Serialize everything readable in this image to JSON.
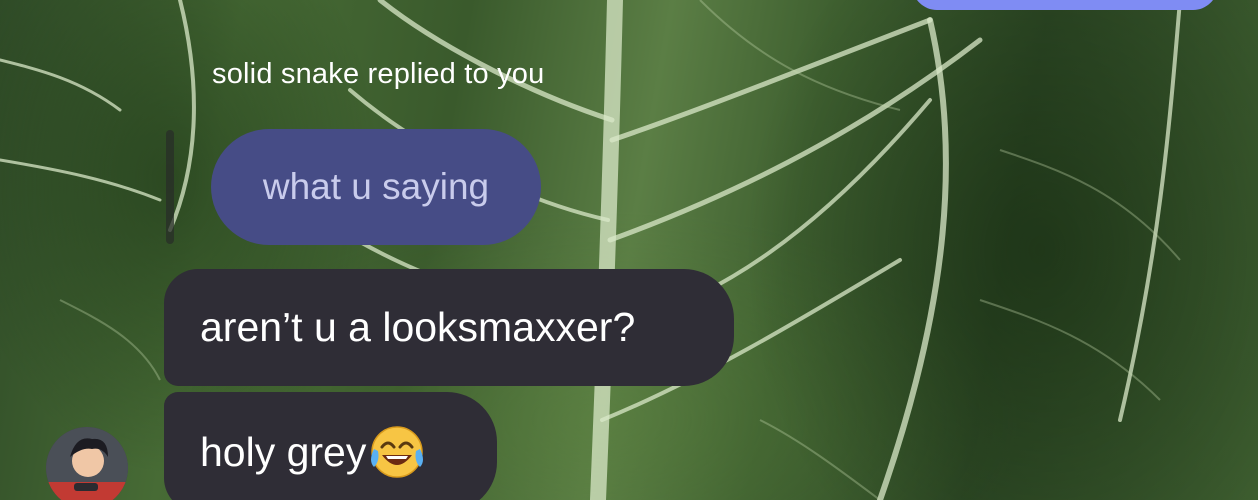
{
  "conversation": {
    "reply_header": "solid snake replied to you",
    "quoted_message": "what u saying",
    "messages": [
      {
        "text": "aren’t u a looksmaxxer?"
      },
      {
        "text": "holy grey",
        "emoji": "face-with-tears-of-joy-icon"
      }
    ],
    "sender_avatar": "user-avatar"
  },
  "colors": {
    "outgoing_bubble": "#7f8cf3",
    "quoted_bubble": "#464c86",
    "incoming_bubble": "#2f2d36",
    "wallpaper": "#3f6030"
  }
}
